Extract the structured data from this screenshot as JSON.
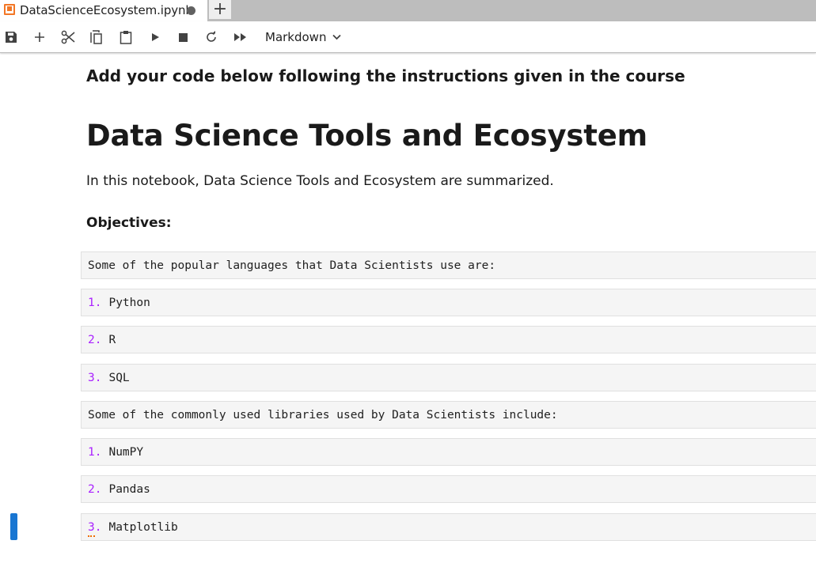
{
  "tab": {
    "title": "DataScienceEcosystem.ipynb",
    "new_tab_label": "+"
  },
  "toolbar": {
    "icons": [
      "save-icon",
      "add-icon",
      "cut-icon",
      "copy-icon",
      "paste-icon",
      "run-icon",
      "stop-icon",
      "restart-icon",
      "run-all-icon"
    ],
    "cell_type": "Markdown"
  },
  "markdown": {
    "instructions": "Add your code below following the instructions given in the course",
    "title": "Data Science Tools and Ecosystem",
    "intro": "In this notebook, Data Science Tools and Ecosystem are summarized.",
    "objectives": "Objectives:"
  },
  "cells": [
    {
      "num": "",
      "text": "Some of the popular languages that Data Scientists use are:"
    },
    {
      "num": "1.",
      "text": "Python"
    },
    {
      "num": "2.",
      "text": "R"
    },
    {
      "num": "3.",
      "text": "SQL"
    },
    {
      "num": "",
      "text": "Some of the commonly used libraries used by Data Scientists include:"
    },
    {
      "num": "1.",
      "text": "NumPY"
    },
    {
      "num": "2.",
      "text": "Pandas"
    },
    {
      "num": "3.",
      "text": "Matplotlib"
    }
  ],
  "colors": {
    "accent": "#1976d2",
    "list_number": "#aa22ff",
    "tab_icon": "#f37726"
  }
}
